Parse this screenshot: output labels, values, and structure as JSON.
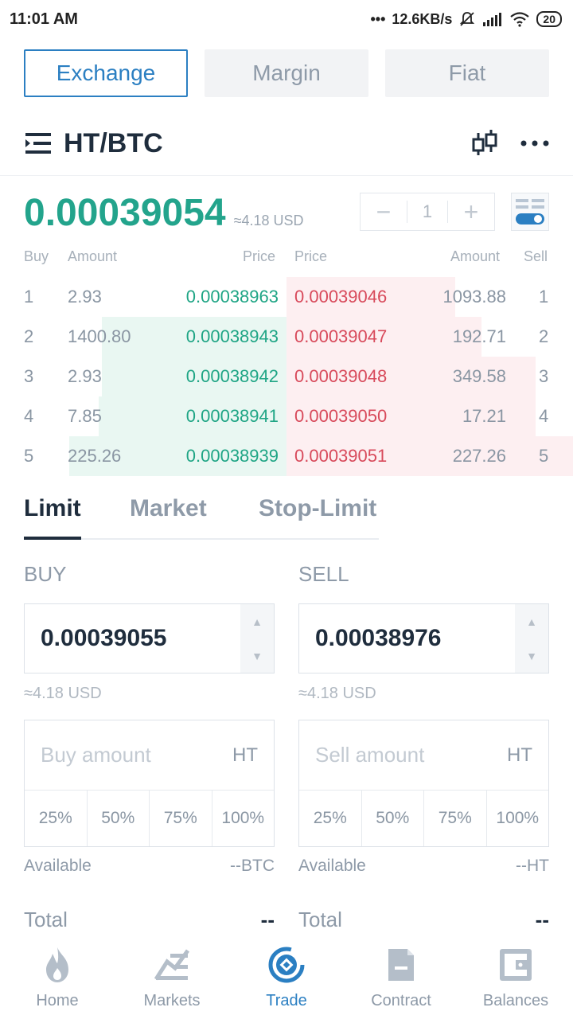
{
  "status_bar": {
    "time": "11:01 AM",
    "speed": "12.6KB/s",
    "battery": "20"
  },
  "top_tabs": [
    {
      "label": "Exchange",
      "active": true
    },
    {
      "label": "Margin",
      "active": false
    },
    {
      "label": "Fiat",
      "active": false
    }
  ],
  "pair": {
    "symbol": "HT/BTC"
  },
  "ticker": {
    "last_price": "0.00039054",
    "usd_estimate": "≈4.18 USD",
    "depth_value": "1"
  },
  "orderbook": {
    "headers": {
      "buy": "Buy",
      "amount_left": "Amount",
      "price_left": "Price",
      "price_right": "Price",
      "amount_right": "Amount",
      "sell": "Sell"
    },
    "rows": [
      {
        "idx": "1",
        "buy_amount": "2.93",
        "buy_price": "0.00038963",
        "sell_price": "0.00039046",
        "sell_amount": "1093.88",
        "buy_depth": 0.0,
        "sell_depth": 0.59
      },
      {
        "idx": "2",
        "buy_amount": "1400.80",
        "buy_price": "0.00038943",
        "sell_price": "0.00039047",
        "sell_amount": "192.71",
        "buy_depth": 0.74,
        "sell_depth": 0.68
      },
      {
        "idx": "3",
        "buy_amount": "2.93",
        "buy_price": "0.00038942",
        "sell_price": "0.00039048",
        "sell_amount": "349.58",
        "buy_depth": 0.74,
        "sell_depth": 0.87
      },
      {
        "idx": "4",
        "buy_amount": "7.85",
        "buy_price": "0.00038941",
        "sell_price": "0.00039050",
        "sell_amount": "17.21",
        "buy_depth": 0.75,
        "sell_depth": 0.87
      },
      {
        "idx": "5",
        "buy_amount": "225.26",
        "buy_price": "0.00038939",
        "sell_price": "0.00039051",
        "sell_amount": "227.26",
        "buy_depth": 0.87,
        "sell_depth": 1.0
      }
    ]
  },
  "order_tabs": [
    {
      "label": "Limit",
      "active": true
    },
    {
      "label": "Market",
      "active": false
    },
    {
      "label": "Stop-Limit",
      "active": false
    }
  ],
  "buy_form": {
    "label": "BUY",
    "price": "0.00039055",
    "usd_estimate": "≈4.18 USD",
    "amount_placeholder": "Buy amount",
    "amount_unit": "HT",
    "percents": [
      "25%",
      "50%",
      "75%",
      "100%"
    ],
    "available_label": "Available",
    "available_value": "--BTC",
    "total_label": "Total",
    "total_value": "--"
  },
  "sell_form": {
    "label": "SELL",
    "price": "0.00038976",
    "usd_estimate": "≈4.18 USD",
    "amount_placeholder": "Sell amount",
    "amount_unit": "HT",
    "percents": [
      "25%",
      "50%",
      "75%",
      "100%"
    ],
    "available_label": "Available",
    "available_value": "--HT",
    "total_label": "Total",
    "total_value": "--"
  },
  "bottom_nav": [
    {
      "label": "Home",
      "icon": "flame-icon",
      "active": false
    },
    {
      "label": "Markets",
      "icon": "markets-icon",
      "active": false
    },
    {
      "label": "Trade",
      "icon": "trade-icon",
      "active": true
    },
    {
      "label": "Contract",
      "icon": "contract-icon",
      "active": false
    },
    {
      "label": "Balances",
      "icon": "wallet-icon",
      "active": false
    }
  ],
  "colors": {
    "accent": "#2b7fc2",
    "buy": "#1fa585",
    "sell": "#d84a5b",
    "last_price": "#23a48c"
  }
}
